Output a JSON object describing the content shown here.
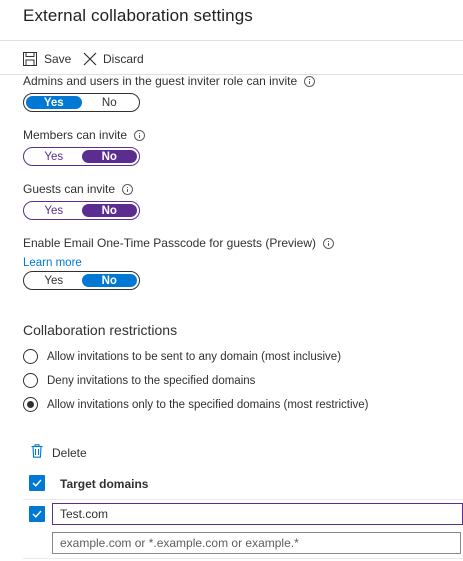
{
  "page": {
    "title": "External collaboration settings"
  },
  "toolbar": {
    "save_label": "Save",
    "discard_label": "Discard"
  },
  "settings": [
    {
      "label": "Admins and users in the guest inviter role can invite",
      "yes": "Yes",
      "no": "No",
      "selected": "Yes"
    },
    {
      "label": "Members can invite",
      "yes": "Yes",
      "no": "No",
      "selected": "No"
    },
    {
      "label": "Guests can invite",
      "yes": "Yes",
      "no": "No",
      "selected": "No"
    },
    {
      "label": "Enable Email One-Time Passcode for guests (Preview)",
      "link": "Learn more",
      "yes": "Yes",
      "no": "No",
      "selected": "No"
    }
  ],
  "restrictions": {
    "title": "Collaboration restrictions",
    "options": [
      {
        "label": "Allow invitations to be sent to any domain (most inclusive)",
        "checked": false
      },
      {
        "label": "Deny invitations to the specified domains",
        "checked": false
      },
      {
        "label": "Allow invitations only to the specified domains (most restrictive)",
        "checked": true
      }
    ]
  },
  "domains": {
    "delete_label": "Delete",
    "column_header": "Target domains",
    "rows": [
      {
        "value": "Test.com",
        "checked": true
      }
    ],
    "new_placeholder": "example.com or *.example.com or example.*"
  },
  "colors": {
    "accent": "#0078d4",
    "purple": "#5c2d91",
    "text": "#323130"
  }
}
